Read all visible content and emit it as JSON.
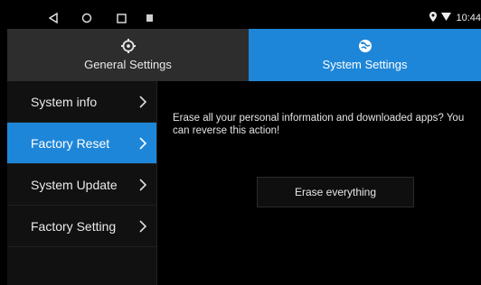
{
  "status_bar": {
    "nav_back_icon": "back-triangle-icon",
    "nav_home_icon": "home-circle-icon",
    "nav_recent_icon": "recent-square-icon",
    "notification_icon": "notification-icon",
    "location_icon": "location-icon",
    "wifi_icon": "wifi-icon",
    "time": "10:44"
  },
  "tabs": [
    {
      "label": "General Settings",
      "icon": "gear-icon",
      "active": false
    },
    {
      "label": "System Settings",
      "icon": "system-globe-icon",
      "active": true
    }
  ],
  "sidebar": {
    "items": [
      {
        "label": "System info",
        "active": false
      },
      {
        "label": "Factory Reset",
        "active": true
      },
      {
        "label": "System Update",
        "active": false
      },
      {
        "label": "Factory Setting",
        "active": false
      }
    ]
  },
  "main": {
    "description": "Erase all your personal information and downloaded apps? You can  reverse this action!",
    "erase_button_label": "Erase everything"
  },
  "colors": {
    "accent": "#1e86d8",
    "background": "#000000",
    "tab_inactive": "#2d2d2d"
  }
}
